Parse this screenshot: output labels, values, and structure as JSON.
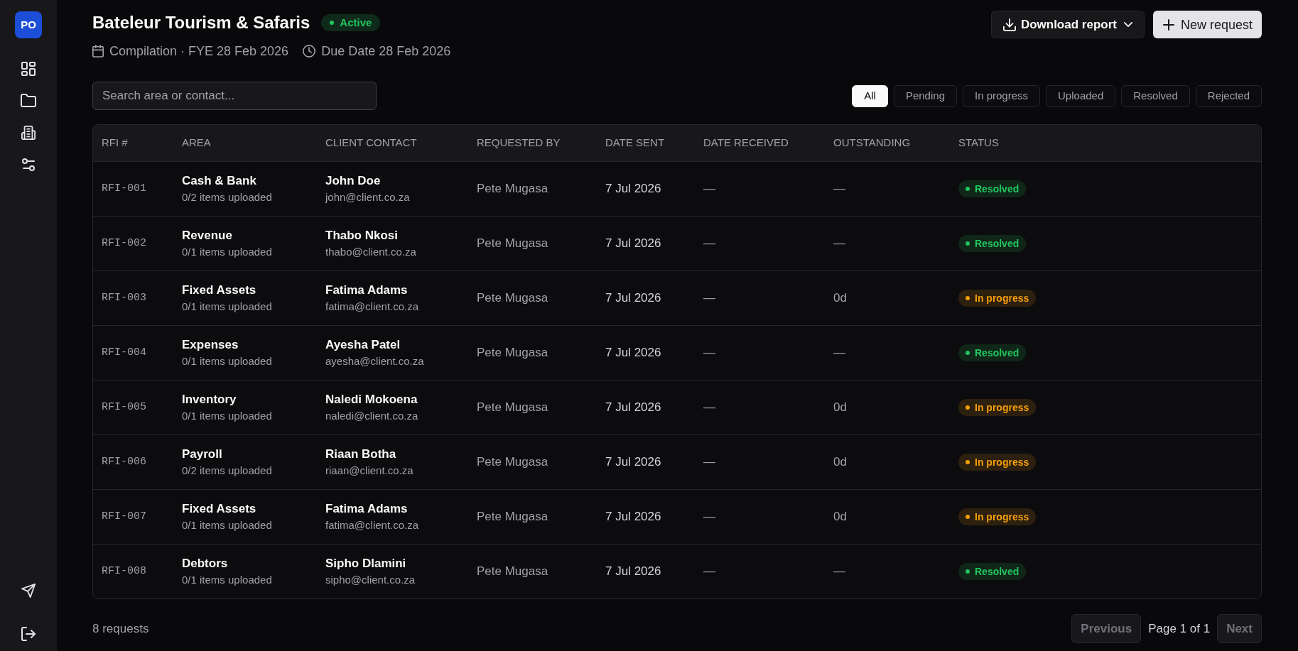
{
  "sidebar": {
    "avatar": "PO"
  },
  "header": {
    "title": "Bateleur Tourism & Safaris",
    "status_badge": "Active",
    "meta": [
      {
        "kind": "calendar",
        "text": "Compilation · FYE 28 Feb 2026"
      },
      {
        "kind": "clock",
        "text": "Due Date 28 Feb 2026"
      }
    ],
    "buttons": [
      {
        "kind": "download",
        "label": "Download report"
      },
      {
        "kind": "add",
        "label": "New request"
      }
    ]
  },
  "search": {
    "placeholder": "Search area or contact..."
  },
  "filters": [
    {
      "label": "All",
      "selected": true
    },
    {
      "label": "Pending",
      "selected": false
    },
    {
      "label": "In progress",
      "selected": false
    },
    {
      "label": "Uploaded",
      "selected": false
    },
    {
      "label": "Resolved",
      "selected": false
    },
    {
      "label": "Rejected",
      "selected": false
    }
  ],
  "table": {
    "columns": [
      "RFI #",
      "AREA",
      "CLIENT CONTACT",
      "REQUESTED BY",
      "DATE SENT",
      "DATE RECEIVED",
      "OUTSTANDING",
      "STATUS"
    ],
    "rows": [
      {
        "rfi": "RFI-001",
        "area": "Cash & Bank",
        "items": "0/2 items uploaded",
        "contact_name": "John Doe",
        "contact_email": "john@client.co.za",
        "requested_by": "Pete Mugasa",
        "date_sent": "7 Jul 2026",
        "date_received": "—",
        "outstanding": "—",
        "status": {
          "label": "Resolved",
          "color": "#22c55e"
        }
      },
      {
        "rfi": "RFI-002",
        "area": "Revenue",
        "items": "0/1 items uploaded",
        "contact_name": "Thabo Nkosi",
        "contact_email": "thabo@client.co.za",
        "requested_by": "Pete Mugasa",
        "date_sent": "7 Jul 2026",
        "date_received": "—",
        "outstanding": "—",
        "status": {
          "label": "Resolved",
          "color": "#22c55e"
        }
      },
      {
        "rfi": "RFI-003",
        "area": "Fixed Assets",
        "items": "0/1 items uploaded",
        "contact_name": "Fatima Adams",
        "contact_email": "fatima@client.co.za",
        "requested_by": "Pete Mugasa",
        "date_sent": "7 Jul 2026",
        "date_received": "—",
        "outstanding": "0d",
        "status": {
          "label": "In progress",
          "color": "#f59e0b"
        }
      },
      {
        "rfi": "RFI-004",
        "area": "Expenses",
        "items": "0/1 items uploaded",
        "contact_name": "Ayesha Patel",
        "contact_email": "ayesha@client.co.za",
        "requested_by": "Pete Mugasa",
        "date_sent": "7 Jul 2026",
        "date_received": "—",
        "outstanding": "—",
        "status": {
          "label": "Resolved",
          "color": "#22c55e"
        }
      },
      {
        "rfi": "RFI-005",
        "area": "Inventory",
        "items": "0/1 items uploaded",
        "contact_name": "Naledi Mokoena",
        "contact_email": "naledi@client.co.za",
        "requested_by": "Pete Mugasa",
        "date_sent": "7 Jul 2026",
        "date_received": "—",
        "outstanding": "0d",
        "status": {
          "label": "In progress",
          "color": "#f59e0b"
        }
      },
      {
        "rfi": "RFI-006",
        "area": "Payroll",
        "items": "0/2 items uploaded",
        "contact_name": "Riaan Botha",
        "contact_email": "riaan@client.co.za",
        "requested_by": "Pete Mugasa",
        "date_sent": "7 Jul 2026",
        "date_received": "—",
        "outstanding": "0d",
        "status": {
          "label": "In progress",
          "color": "#f59e0b"
        }
      },
      {
        "rfi": "RFI-007",
        "area": "Fixed Assets",
        "items": "0/1 items uploaded",
        "contact_name": "Fatima Adams",
        "contact_email": "fatima@client.co.za",
        "requested_by": "Pete Mugasa",
        "date_sent": "7 Jul 2026",
        "date_received": "—",
        "outstanding": "0d",
        "status": {
          "label": "In progress",
          "color": "#f59e0b"
        }
      },
      {
        "rfi": "RFI-008",
        "area": "Debtors",
        "items": "0/1 items uploaded",
        "contact_name": "Sipho Dlamini",
        "contact_email": "sipho@client.co.za",
        "requested_by": "Pete Mugasa",
        "date_sent": "7 Jul 2026",
        "date_received": "—",
        "outstanding": "—",
        "status": {
          "label": "Resolved",
          "color": "#22c55e"
        }
      }
    ]
  },
  "footer": {
    "count": "8 requests",
    "pagination": {
      "previous": {
        "label": "Previous",
        "disabled": true
      },
      "page": "Page 1 of 1",
      "next": {
        "label": "Next",
        "disabled": true
      }
    }
  }
}
